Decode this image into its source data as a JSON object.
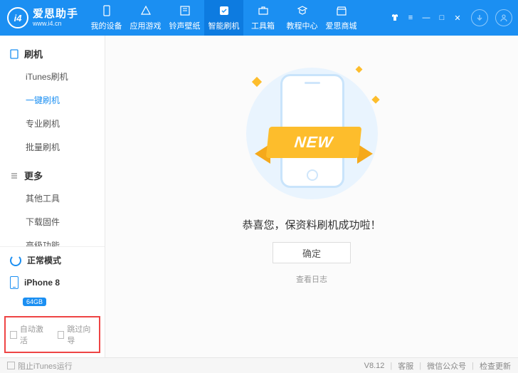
{
  "app": {
    "name": "爱思助手",
    "url": "www.i4.cn",
    "logo_text": "i4"
  },
  "topnav": [
    {
      "label": "我的设备"
    },
    {
      "label": "应用游戏"
    },
    {
      "label": "铃声壁纸"
    },
    {
      "label": "智能刷机"
    },
    {
      "label": "工具箱"
    },
    {
      "label": "教程中心"
    },
    {
      "label": "爱思商城"
    }
  ],
  "sidebar": {
    "group1": {
      "title": "刷机"
    },
    "items1": [
      {
        "label": "iTunes刷机"
      },
      {
        "label": "一键刷机"
      },
      {
        "label": "专业刷机"
      },
      {
        "label": "批量刷机"
      }
    ],
    "group2": {
      "title": "更多"
    },
    "items2": [
      {
        "label": "其他工具"
      },
      {
        "label": "下载固件"
      },
      {
        "label": "高级功能"
      }
    ],
    "mode": "正常模式",
    "device": "iPhone 8",
    "storage": "64GB",
    "chk_auto": "自动激活",
    "chk_skip": "跳过向导"
  },
  "main": {
    "ribbon": "NEW",
    "success": "恭喜您，保资料刷机成功啦！",
    "ok": "确定",
    "log": "查看日志"
  },
  "status": {
    "block_itunes": "阻止iTunes运行",
    "version": "V8.12",
    "support": "客服",
    "wechat": "微信公众号",
    "update": "检查更新"
  }
}
